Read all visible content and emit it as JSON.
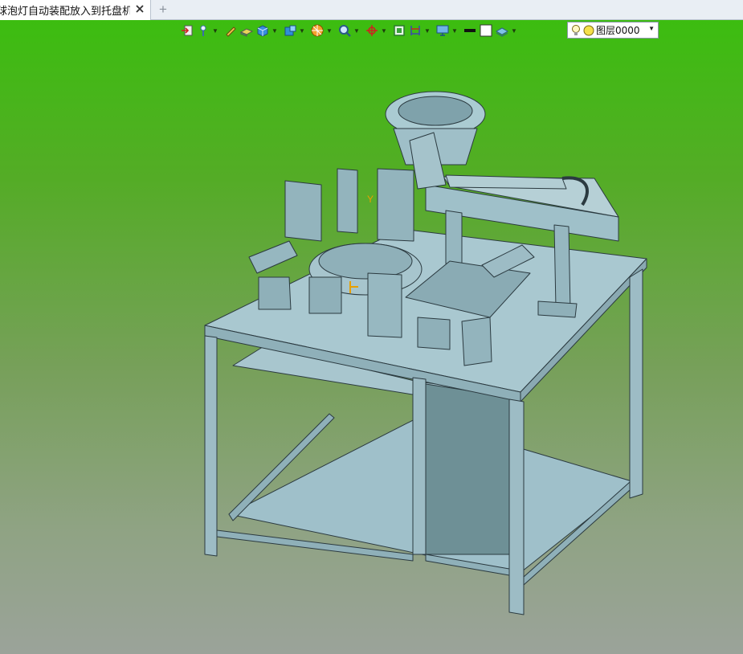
{
  "tab": {
    "title": "球泡灯自动装配放入到托盘机]",
    "close_icon": "close-icon",
    "new_tab_icon": "plus-icon",
    "new_tab_glyph": "+"
  },
  "toolbar": {
    "tools": [
      {
        "name": "exit-sketch-icon",
        "dropdown": false
      },
      {
        "name": "light-probe-icon",
        "dropdown": true
      },
      {
        "name": "pencil-icon",
        "dropdown": false
      },
      {
        "name": "eraser-icon",
        "dropdown": false
      },
      {
        "name": "shaded-cube-icon",
        "dropdown": true
      },
      {
        "name": "view-cube-icon",
        "dropdown": true
      },
      {
        "name": "section-view-icon",
        "dropdown": true
      },
      {
        "name": "zoom-view-icon",
        "dropdown": true
      },
      {
        "name": "coordinate-axis-icon",
        "dropdown": true
      },
      {
        "name": "green-frame-icon",
        "dropdown": false
      },
      {
        "name": "dimension-icon",
        "dropdown": true
      },
      {
        "name": "display-monitor-icon",
        "dropdown": true
      },
      {
        "name": "line-color-icon",
        "dropdown": false
      },
      {
        "name": "fill-color-icon",
        "dropdown": false
      },
      {
        "name": "layer-stack-icon",
        "dropdown": true
      }
    ],
    "layer": {
      "value": "图层0000",
      "bulb_icon": "bulb-icon",
      "status_icon": "yellow-circle-icon"
    }
  },
  "colors": {
    "tab_bg": "#ffffff",
    "viewport_top": "#3cbd10",
    "viewport_bottom": "#9ba39a",
    "model_fill": "#9fbfc8",
    "model_edge": "#2b3a40",
    "axis_label": "#e8a000"
  },
  "viewport": {
    "axis_label": "Y"
  }
}
